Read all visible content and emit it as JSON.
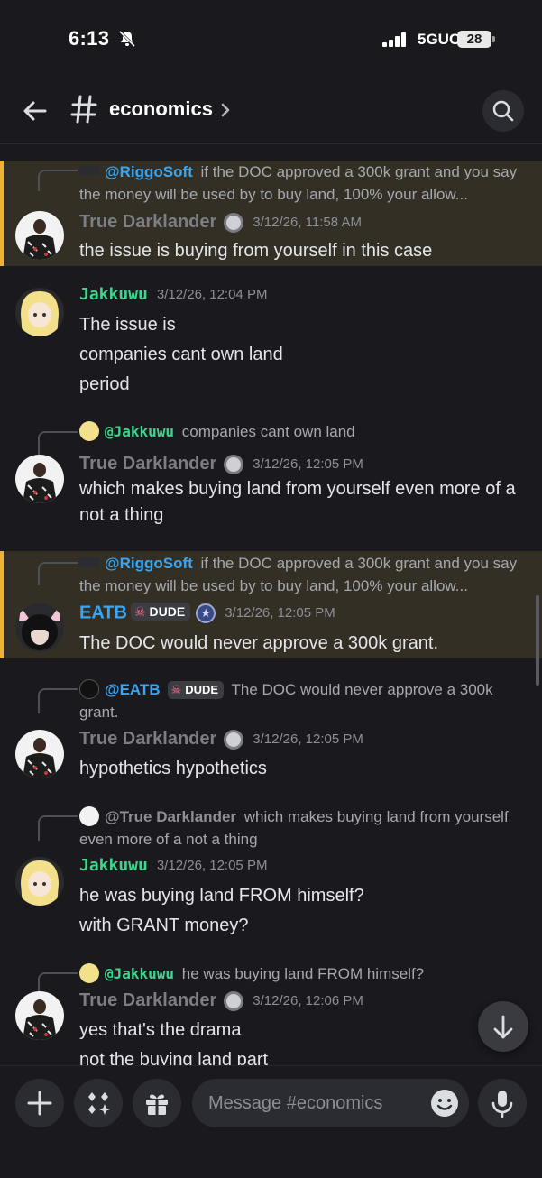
{
  "status": {
    "time": "6:13",
    "network": "5GUC",
    "battery": "28"
  },
  "header": {
    "channel": "economics"
  },
  "messages": [
    {
      "reply": {
        "mention": "@RiggoSoft",
        "text": "if the DOC approved a 300k grant and you say the money will be used by to buy land, 100% your allow..."
      },
      "author": "True Darklander",
      "time": "3/12/26, 11:58 AM",
      "lines": [
        "the issue is buying from yourself in this case"
      ]
    },
    {
      "author": "Jakkuwu",
      "time": "3/12/26, 12:04 PM",
      "lines": [
        "The issue is",
        "companies cant own land",
        "period"
      ]
    },
    {
      "reply": {
        "mention": "@Jakkuwu",
        "text": "companies cant own land"
      },
      "author": "True Darklander",
      "time": "3/12/26, 12:05 PM",
      "lines": [
        "which makes buying land from yourself even more of a not a thing"
      ]
    },
    {
      "reply": {
        "mention": "@RiggoSoft",
        "text": "if the DOC approved a 300k grant and you say the money will be used by to buy land, 100% your allow..."
      },
      "author": "EATB",
      "tag": "DUDE",
      "time": "3/12/26, 12:05 PM",
      "lines": [
        "The DOC would never approve a 300k grant."
      ]
    },
    {
      "reply": {
        "mention": "@EATB",
        "tag": "DUDE",
        "text": "The DOC would never approve a 300k grant."
      },
      "author": "True Darklander",
      "time": "3/12/26, 12:05 PM",
      "lines": [
        "hypothetics hypothetics"
      ]
    },
    {
      "reply": {
        "mention": "@True Darklander",
        "text": "which makes buying land from yourself even more of a not a thing"
      },
      "author": "Jakkuwu",
      "time": "3/12/26, 12:05 PM",
      "lines": [
        "he was buying land FROM himself?",
        "with GRANT money?"
      ]
    },
    {
      "reply": {
        "mention": "@Jakkuwu",
        "text": "he was buying land FROM himself?"
      },
      "author": "True Darklander",
      "time": "3/12/26, 12:06 PM",
      "lines": [
        "yes that's the drama",
        "not the buying land part"
      ]
    }
  ],
  "composer": {
    "placeholder": "Message #economics"
  },
  "icons": [
    "back-arrow-icon",
    "hash-icon",
    "chevron-right-icon",
    "search-icon",
    "plus-icon",
    "apps-icon",
    "gift-icon",
    "emoji-icon",
    "microphone-icon",
    "arrow-down-icon",
    "bell-off-icon",
    "signal-icon"
  ],
  "colors": {
    "highlight_bg": "#332f25",
    "highlight_bar": "#f0b232",
    "mention_blue": "#3aa5f0",
    "jakkuwu_green": "#3dd68c"
  }
}
